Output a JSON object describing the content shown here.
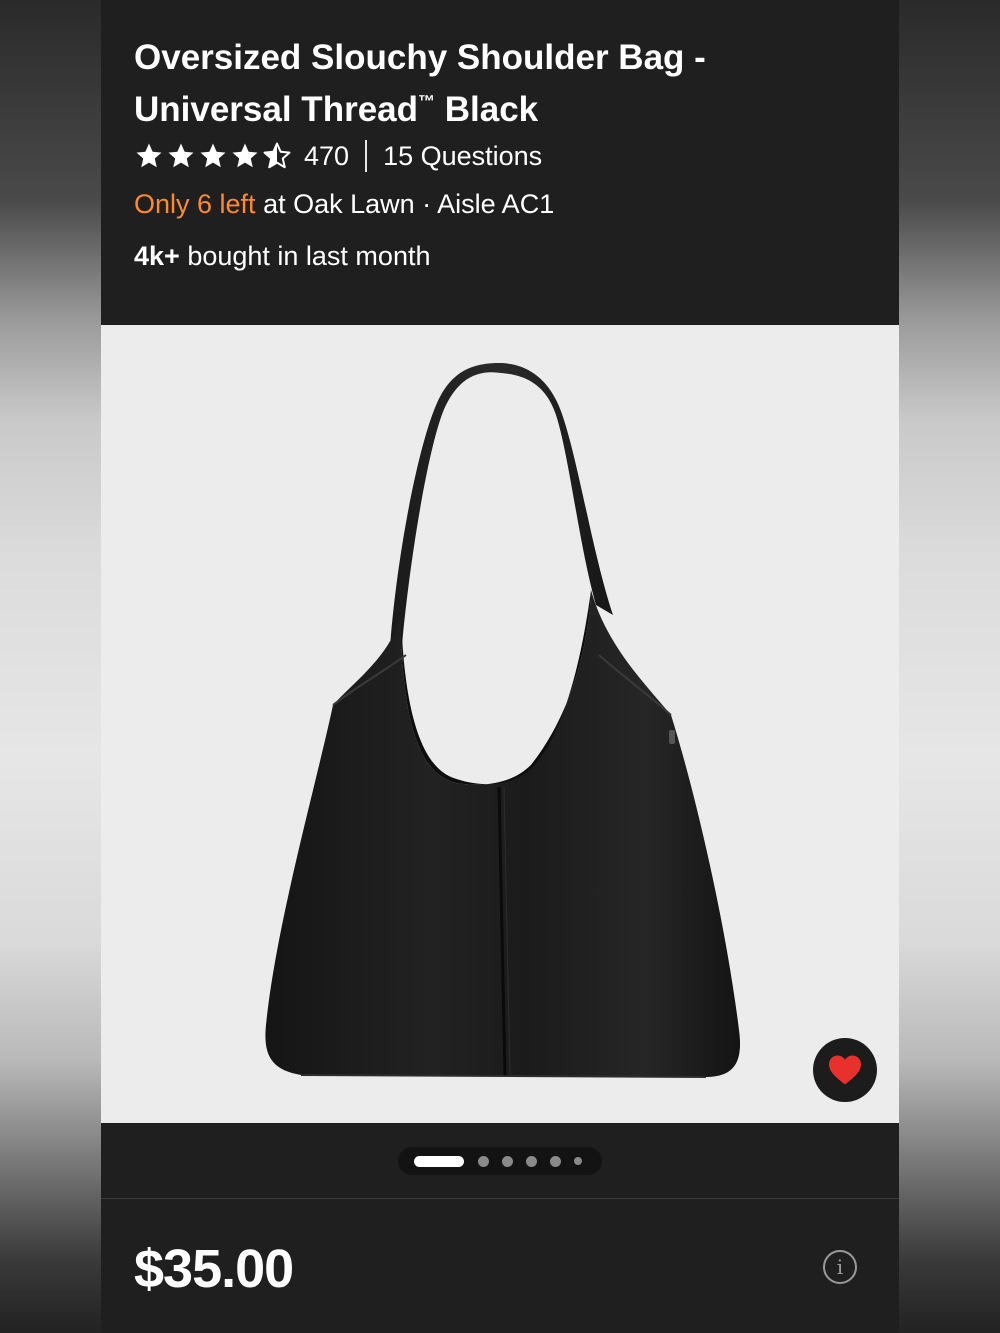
{
  "product": {
    "title_main": "Oversized Slouchy Shoulder Bag - Universal Thread",
    "trademark": "™",
    "title_tail": " Black"
  },
  "rating": {
    "stars": 4.5,
    "max_stars": 5,
    "review_count": "470",
    "questions": "15 Questions"
  },
  "stock": {
    "urgency": "Only 6 left",
    "location": " at Oak Lawn · Aisle AC1",
    "urgency_color": "#ff8a2a"
  },
  "social_proof": {
    "count": "4k+",
    "text": " bought in last month"
  },
  "gallery": {
    "image_name": "black-shoulder-bag",
    "current_index": 1,
    "total_images": 6,
    "favorite_icon": "heart-icon",
    "favorite_color": "#e8302c"
  },
  "price": {
    "value": "$35.00",
    "info_icon": "info-icon",
    "info_glyph": "i"
  }
}
